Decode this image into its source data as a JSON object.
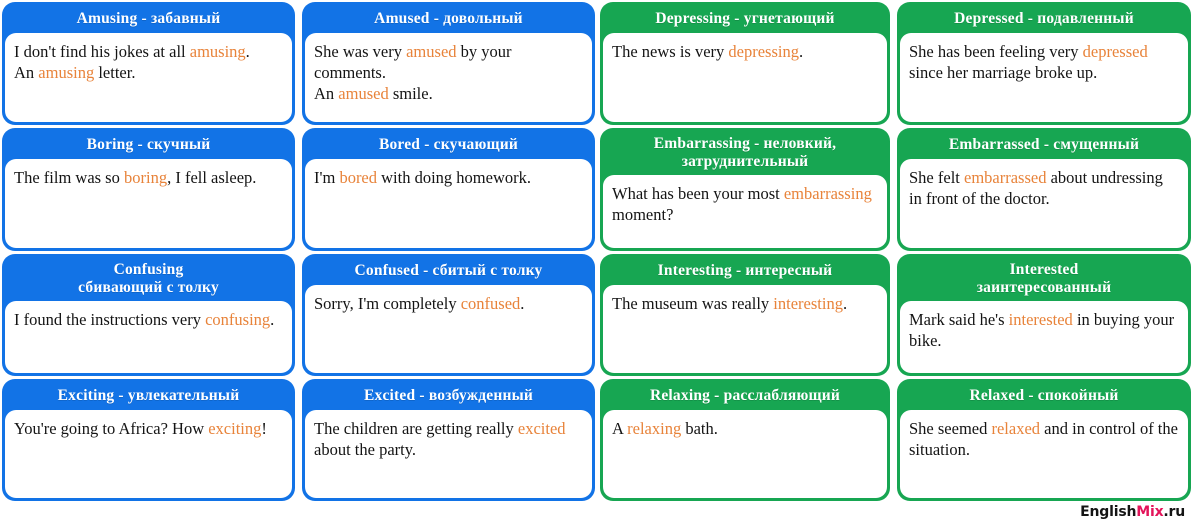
{
  "colors": {
    "blue": "#1273e6",
    "green": "#17a652",
    "highlight": "#e8833a",
    "body_text": "#141414",
    "header_text": "#ffffff",
    "watermark_accent": "#e3145a"
  },
  "watermark": {
    "prefix": "English",
    "accent": "Mix",
    "suffix": ".ru"
  },
  "cards": [
    {
      "color": "blue",
      "title_line1": "Amusing - забавный",
      "title_line2": "",
      "sentences": [
        [
          {
            "t": "I don't find his jokes at all ",
            "h": false
          },
          {
            "t": "amusing",
            "h": true
          },
          {
            "t": ".",
            "h": false
          }
        ],
        [
          {
            "t": "An ",
            "h": false
          },
          {
            "t": "amusing",
            "h": true
          },
          {
            "t": " letter.",
            "h": false
          }
        ]
      ]
    },
    {
      "color": "blue",
      "title_line1": "Amused - довольный",
      "title_line2": "",
      "sentences": [
        [
          {
            "t": "She was very ",
            "h": false
          },
          {
            "t": "amused",
            "h": true
          },
          {
            "t": " by your comments.",
            "h": false
          }
        ],
        [
          {
            "t": "An ",
            "h": false
          },
          {
            "t": "amused",
            "h": true
          },
          {
            "t": " smile.",
            "h": false
          }
        ]
      ]
    },
    {
      "color": "green",
      "title_line1": "Depressing - угнетающий",
      "title_line2": "",
      "sentences": [
        [
          {
            "t": "The news is very ",
            "h": false
          },
          {
            "t": "depressing",
            "h": true
          },
          {
            "t": ".",
            "h": false
          }
        ]
      ]
    },
    {
      "color": "green",
      "title_line1": "Depressed - подавленный",
      "title_line2": "",
      "sentences": [
        [
          {
            "t": "She has been feeling very ",
            "h": false
          },
          {
            "t": "depressed",
            "h": true
          },
          {
            "t": " since her marriage broke up.",
            "h": false
          }
        ]
      ]
    },
    {
      "color": "blue",
      "title_line1": "Boring - скучный",
      "title_line2": "",
      "sentences": [
        [
          {
            "t": "The film was so ",
            "h": false
          },
          {
            "t": "boring",
            "h": true
          },
          {
            "t": ", I fell asleep.",
            "h": false
          }
        ]
      ]
    },
    {
      "color": "blue",
      "title_line1": "Bored - скучающий",
      "title_line2": "",
      "sentences": [
        [
          {
            "t": "I'm ",
            "h": false
          },
          {
            "t": "bored",
            "h": true
          },
          {
            "t": " with doing homework.",
            "h": false
          }
        ]
      ]
    },
    {
      "color": "green",
      "title_line1": "Embarrassing - неловкий,",
      "title_line2": "затруднительный",
      "sentences": [
        [
          {
            "t": "What has been your most ",
            "h": false
          },
          {
            "t": "embarrassing",
            "h": true
          },
          {
            "t": " moment?",
            "h": false
          }
        ]
      ]
    },
    {
      "color": "green",
      "title_line1": "Embarrassed - смущенный",
      "title_line2": "",
      "sentences": [
        [
          {
            "t": "She felt ",
            "h": false
          },
          {
            "t": "embarrassed",
            "h": true
          },
          {
            "t": " about undressing in front of the doctor.",
            "h": false
          }
        ]
      ]
    },
    {
      "color": "blue",
      "title_line1": "Confusing",
      "title_line2": "сбивающий с толку",
      "sentences": [
        [
          {
            "t": "I found the instructions very ",
            "h": false
          },
          {
            "t": "confusing",
            "h": true
          },
          {
            "t": ".",
            "h": false
          }
        ]
      ]
    },
    {
      "color": "blue",
      "title_line1": "Confused - сбитый с толку",
      "title_line2": "",
      "sentences": [
        [
          {
            "t": "Sorry, I'm completely ",
            "h": false
          },
          {
            "t": "confused",
            "h": true
          },
          {
            "t": ".",
            "h": false
          }
        ]
      ]
    },
    {
      "color": "green",
      "title_line1": "Interesting - интересный",
      "title_line2": "",
      "sentences": [
        [
          {
            "t": "The museum was really ",
            "h": false
          },
          {
            "t": "interesting",
            "h": true
          },
          {
            "t": ".",
            "h": false
          }
        ]
      ]
    },
    {
      "color": "green",
      "title_line1": "Interested",
      "title_line2": "заинтересованный",
      "sentences": [
        [
          {
            "t": "Mark said he's ",
            "h": false
          },
          {
            "t": "interested",
            "h": true
          },
          {
            "t": " in buying your bike.",
            "h": false
          }
        ]
      ]
    },
    {
      "color": "blue",
      "title_line1": "Exciting - увлекательный",
      "title_line2": "",
      "sentences": [
        [
          {
            "t": "You're going to Africa? How ",
            "h": false
          },
          {
            "t": "exciting",
            "h": true
          },
          {
            "t": "!",
            "h": false
          }
        ]
      ]
    },
    {
      "color": "blue",
      "title_line1": "Excited - возбужденный",
      "title_line2": "",
      "sentences": [
        [
          {
            "t": "The children are getting really ",
            "h": false
          },
          {
            "t": "excited",
            "h": true
          },
          {
            "t": " about the party.",
            "h": false
          }
        ]
      ]
    },
    {
      "color": "green",
      "title_line1": "Relaxing - расслабляющий",
      "title_line2": "",
      "sentences": [
        [
          {
            "t": "A ",
            "h": false
          },
          {
            "t": "relaxing",
            "h": true
          },
          {
            "t": " bath.",
            "h": false
          }
        ]
      ]
    },
    {
      "color": "green",
      "title_line1": "Relaxed - спокойный",
      "title_line2": "",
      "sentences": [
        [
          {
            "t": "She seemed ",
            "h": false
          },
          {
            "t": "relaxed",
            "h": true
          },
          {
            "t": " and in control of the situation.",
            "h": false
          }
        ]
      ]
    }
  ]
}
